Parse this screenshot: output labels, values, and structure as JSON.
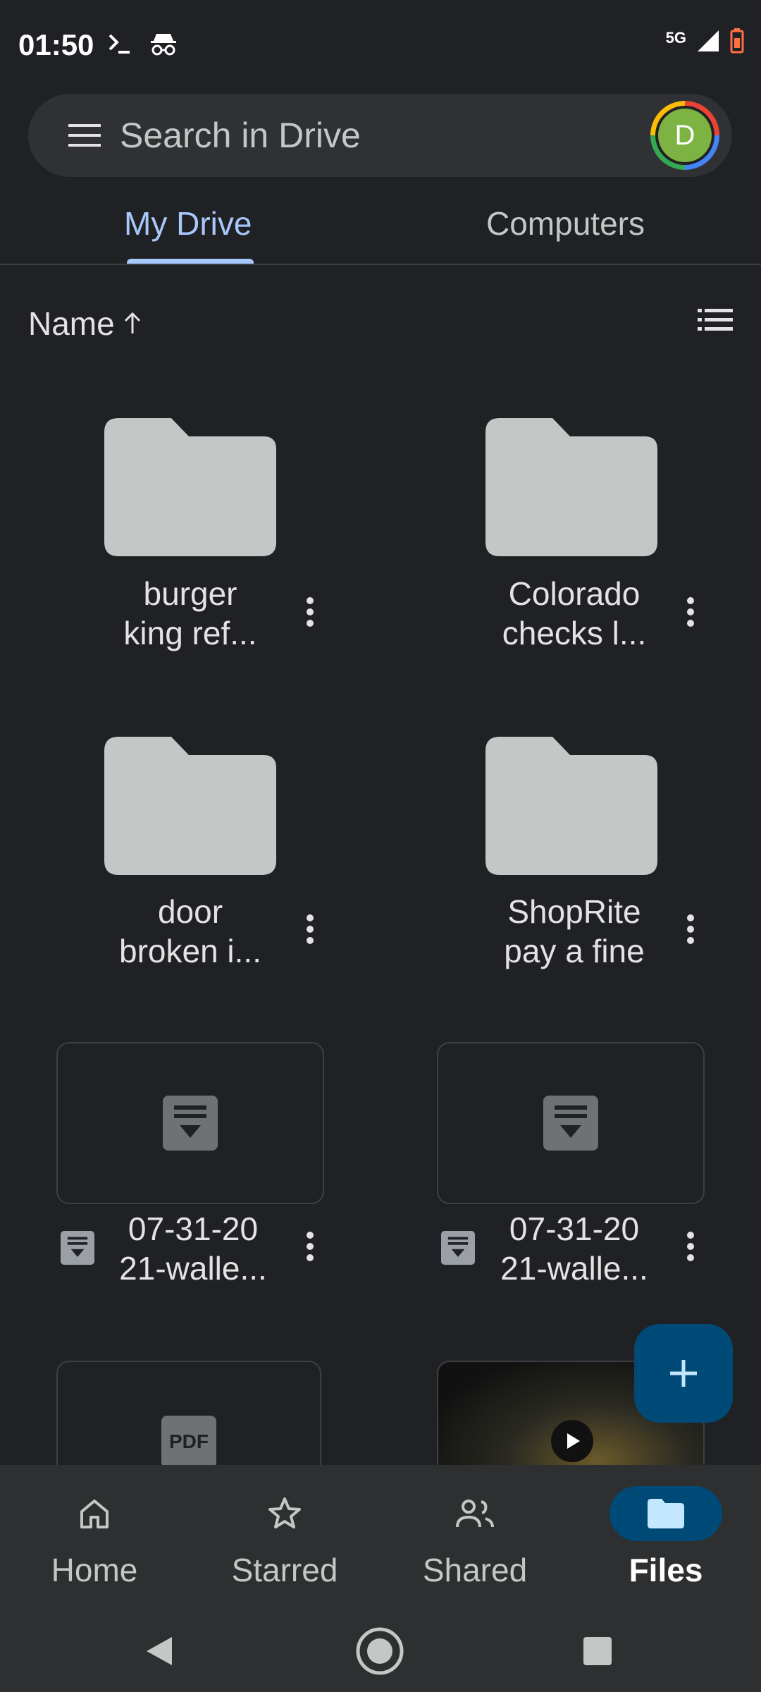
{
  "status_bar": {
    "time": "01:50",
    "network": "5G",
    "icons": [
      "terminal-icon",
      "incognito-icon",
      "signal-icon",
      "battery-icon"
    ]
  },
  "search": {
    "placeholder": "Search in Drive",
    "avatar_letter": "D"
  },
  "tabs": [
    {
      "label": "My Drive",
      "selected": true
    },
    {
      "label": "Computers",
      "selected": false
    }
  ],
  "sort": {
    "label": "Name",
    "direction": "ascending"
  },
  "items": [
    {
      "type": "folder",
      "name_line1": "burger",
      "name_line2": "king ref..."
    },
    {
      "type": "folder",
      "name_line1": "Colorado",
      "name_line2": "checks l..."
    },
    {
      "type": "folder",
      "name_line1": "door",
      "name_line2": "broken i..."
    },
    {
      "type": "folder",
      "name_line1": "ShopRite",
      "name_line2": "pay a fine"
    },
    {
      "type": "document",
      "name_line1": "07-31-20",
      "name_line2": "21-walle..."
    },
    {
      "type": "document",
      "name_line1": "07-31-20",
      "name_line2": "21-walle..."
    },
    {
      "type": "pdf",
      "badge": "PDF"
    },
    {
      "type": "video"
    }
  ],
  "bottom_nav": [
    {
      "label": "Home",
      "icon": "home-icon",
      "active": false
    },
    {
      "label": "Starred",
      "icon": "star-icon",
      "active": false
    },
    {
      "label": "Shared",
      "icon": "people-icon",
      "active": false
    },
    {
      "label": "Files",
      "icon": "folder-icon",
      "active": true
    }
  ],
  "colors": {
    "background": "#202124",
    "accent": "#a8c7fa",
    "fab": "#004a77",
    "folder": "#c4c7c5"
  }
}
